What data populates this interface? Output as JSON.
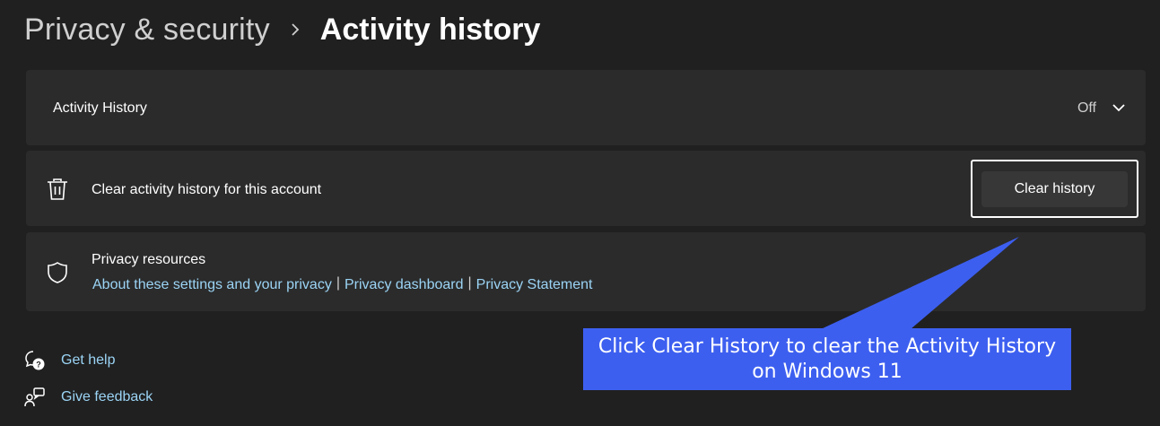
{
  "breadcrumb": {
    "parent": "Privacy & security",
    "separator_icon": "chevron-right-icon",
    "current": "Activity history"
  },
  "activity_history": {
    "label": "Activity History",
    "status": "Off",
    "expand_icon": "chevron-down-icon"
  },
  "clear_history": {
    "icon": "trash-icon",
    "label": "Clear activity history for this account",
    "button_label": "Clear history"
  },
  "privacy_resources": {
    "icon": "shield-icon",
    "title": "Privacy resources",
    "links": [
      "About these settings and your privacy",
      "Privacy dashboard",
      "Privacy Statement"
    ],
    "separator": "|"
  },
  "footer": {
    "help_icon": "help-chat-icon",
    "help_label": "Get help",
    "feedback_icon": "feedback-icon",
    "feedback_label": "Give feedback"
  },
  "callout": {
    "line1": "Click Clear History to clear the Activity History",
    "line2": "on Windows 11",
    "color": "#3d5ff0"
  },
  "colors": {
    "background": "#202020",
    "card": "#2b2b2b",
    "link": "#9bd4f5",
    "button": "#373737"
  }
}
